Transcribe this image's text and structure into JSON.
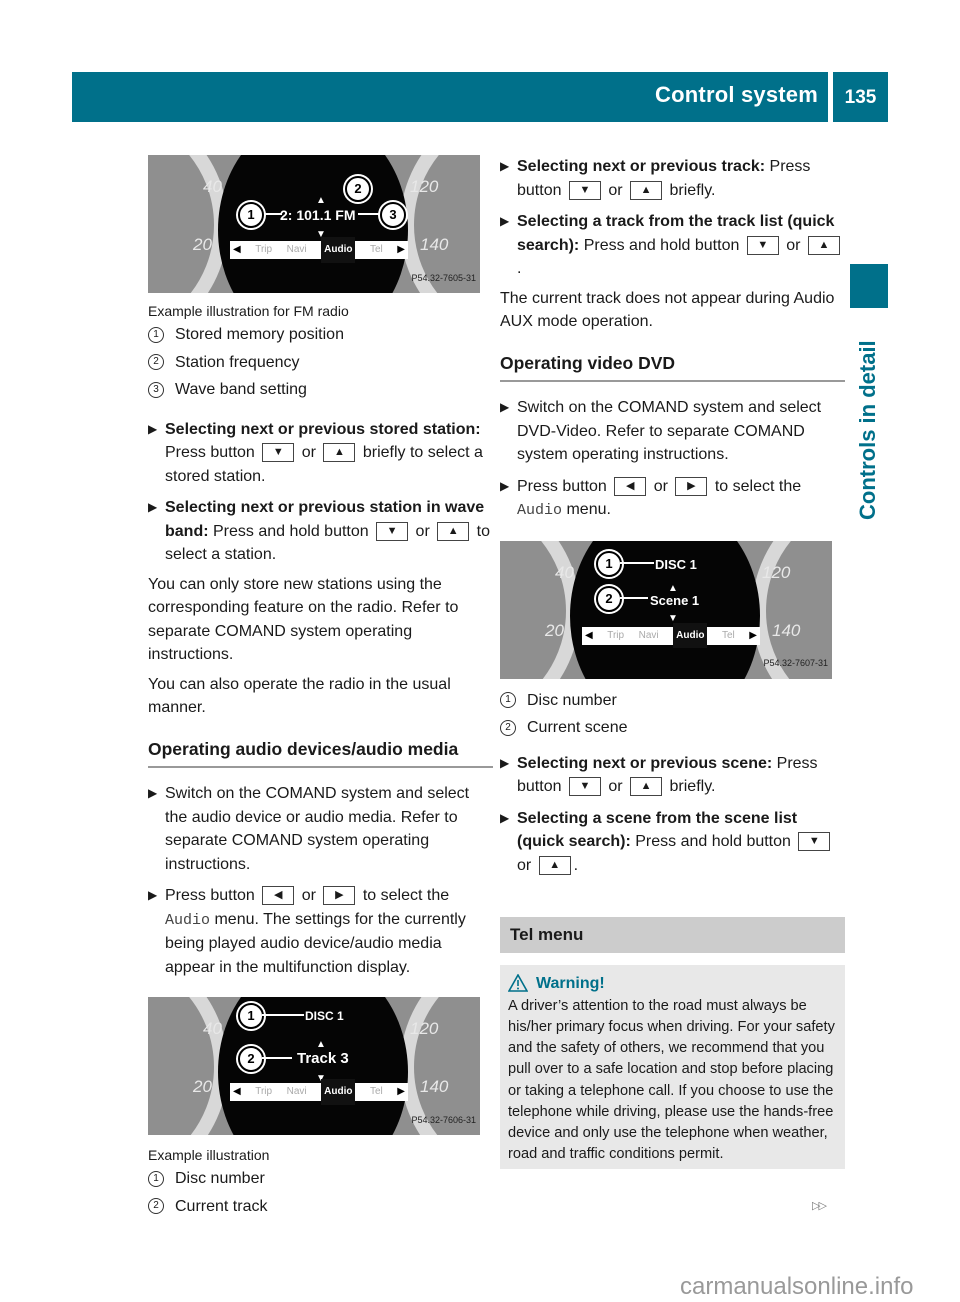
{
  "header": {
    "title": "Control system",
    "page_number": "135"
  },
  "sidebar": {
    "section_label": "Controls in detail"
  },
  "figure_fm": {
    "speed_labels": [
      "40",
      "20",
      "120",
      "140"
    ],
    "display_text": "2: 101.1 FM",
    "menu_items": [
      "Trip",
      "Navi",
      "Audio",
      "Tel"
    ],
    "selected_menu": "Audio",
    "callouts": [
      "1",
      "2",
      "3"
    ],
    "code": "P54.32-7605-31",
    "caption": "Example illustration for FM radio"
  },
  "legend_fm": [
    {
      "num": "1",
      "label": "Stored memory position"
    },
    {
      "num": "2",
      "label": "Station frequency"
    },
    {
      "num": "3",
      "label": "Wave band setting"
    }
  ],
  "left_bullets_1": [
    {
      "bold": "Selecting next or previous stored station:",
      "t1": " Press button ",
      "k1": "▼",
      "t2": " or ",
      "k2": "▲",
      "t3": " briefly to select a stored station."
    },
    {
      "bold": "Selecting next or previous station in wave band:",
      "t1": " Press and hold button ",
      "k1": "▼",
      "t2": " or ",
      "k2": "▲",
      "t3": " to select a station."
    }
  ],
  "left_paragraphs": [
    "You can only store new stations using the corresponding feature on the radio. Refer to separate COMAND system operating instructions.",
    "You can also operate the radio in the usual manner."
  ],
  "section_audio": {
    "title": "Operating audio devices/audio media",
    "bullet1": "Switch on the COMAND system and select the audio device or audio media. Refer to separate COMAND system operating instructions.",
    "bullet2": {
      "t1": "Press button ",
      "k1": "◀",
      "t2": " or ",
      "k2": "▶",
      "t3": " to select the ",
      "mono": "Audio",
      "t4": " menu. The settings for the currently being played audio device/audio media appear in the multifunction display."
    }
  },
  "figure_track": {
    "line1": "DISC 1",
    "line2": "Track 3",
    "code": "P54.32-7606-31",
    "caption": "Example illustration"
  },
  "legend_track": [
    {
      "num": "1",
      "label": "Disc number"
    },
    {
      "num": "2",
      "label": "Current track"
    }
  ],
  "right_bullets_1": [
    {
      "bold": "Selecting next or previous track:",
      "t1": " Press button ",
      "k1": "▼",
      "t2": " or ",
      "k2": "▲",
      "t3": " briefly."
    },
    {
      "bold": "Selecting a track from the track list (quick search):",
      "t1": " Press and hold button ",
      "k1": "▼",
      "t2": " or ",
      "k2": "▲",
      "t3": "."
    }
  ],
  "right_paragraph": "The current track does not appear during Audio AUX mode operation.",
  "section_dvd": {
    "title": "Operating video DVD",
    "bullet1": "Switch on the COMAND system and select DVD-Video. Refer to separate COMAND system operating instructions.",
    "bullet2": {
      "t1": "Press button ",
      "k1": "◀",
      "t2": " or ",
      "k2": "▶",
      "t3": " to select the ",
      "mono": "Audio",
      "t4": " menu."
    }
  },
  "figure_scene": {
    "line1": "DISC 1",
    "line2": "Scene 1",
    "code": "P54.32-7607-31"
  },
  "legend_scene": [
    {
      "num": "1",
      "label": "Disc number"
    },
    {
      "num": "2",
      "label": "Current scene"
    }
  ],
  "right_bullets_2": [
    {
      "bold": "Selecting next or previous scene:",
      "t1": " Press button ",
      "k1": "▼",
      "t2": " or ",
      "k2": "▲",
      "t3": " briefly."
    },
    {
      "bold": "Selecting a scene from the scene list (quick search):",
      "t1": " Press and hold button ",
      "k1": "▼",
      "t2": " or ",
      "k2": "▲",
      "t3": "."
    }
  ],
  "tel_menu": {
    "title": "Tel menu",
    "warning_title": "Warning!",
    "warning_text": "A driver’s attention to the road must always be his/her primary focus when driving. For your safety and the safety of others, we recommend that you pull over to a safe location and stop before placing or taking a telephone call. If you choose to use the telephone while driving, please use the hands-free device and only use the telephone when weather, road and traffic conditions permit."
  },
  "footer": {
    "continue_icon": "▷▷",
    "watermark": "carmanualsonline.info"
  },
  "colors": {
    "accent": "#00708a",
    "heading_bg": "#cccccc",
    "warning_bg": "#e8e8e8"
  }
}
